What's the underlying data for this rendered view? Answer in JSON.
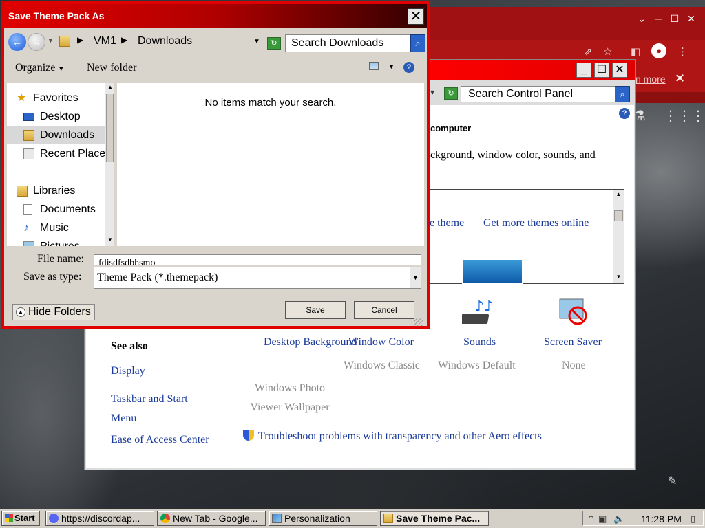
{
  "dialog": {
    "title": "Save Theme Pack As",
    "close_label": "✕",
    "breadcrumb": [
      "VM1",
      "Downloads"
    ],
    "search_placeholder": "Search Downloads",
    "toolbar": {
      "organize": "Organize",
      "new_folder": "New folder"
    },
    "nav_items": [
      {
        "label": "Favorites",
        "icon": "star-icon",
        "level": "top"
      },
      {
        "label": "Desktop",
        "icon": "desktop-icon",
        "level": "child"
      },
      {
        "label": "Downloads",
        "icon": "downloads-folder-icon",
        "level": "child",
        "selected": true
      },
      {
        "label": "Recent Places",
        "icon": "recent-places-icon",
        "level": "child"
      },
      {
        "label": "Libraries",
        "icon": "libraries-icon",
        "level": "top"
      },
      {
        "label": "Documents",
        "icon": "documents-icon",
        "level": "child"
      },
      {
        "label": "Music",
        "icon": "music-icon",
        "level": "child"
      },
      {
        "label": "Pictures",
        "icon": "pictures-icon",
        "level": "child"
      }
    ],
    "empty_message": "No items match your search.",
    "file_name_label": "File name:",
    "file_name_value": "fdjsdfsdbhsmo",
    "save_type_label": "Save as type:",
    "save_type_value": "Theme Pack (*.themepack)",
    "hide_folders": "Hide Folders",
    "save_button": "Save",
    "cancel_button": "Cancel"
  },
  "control_panel": {
    "search_placeholder": "Search Control Panel",
    "heading_fragment": "computer",
    "description_fragment": "ckground, window color, sounds, and",
    "links": {
      "save_theme_fragment": "e theme",
      "get_more_themes": "Get more themes online"
    },
    "settings": [
      {
        "title": "Desktop Background",
        "value": "Windows Photo Viewer Wallpaper",
        "icon": "desktop-background-icon"
      },
      {
        "title": "Window Color",
        "value": "Windows Classic",
        "icon": "window-color-icon"
      },
      {
        "title": "Sounds",
        "value": "Windows Default",
        "icon": "sounds-icon"
      },
      {
        "title": "Screen Saver",
        "value": "None",
        "icon": "screen-saver-icon"
      }
    ],
    "see_also_title": "See also",
    "see_also_links": [
      "Display",
      "Taskbar and Start Menu",
      "Ease of Access Center"
    ],
    "troubleshoot_link": "Troubleshoot problems with transparency and other Aero effects"
  },
  "chrome": {
    "learn_more": "n more"
  },
  "taskbar": {
    "start_label": "Start",
    "tasks": [
      {
        "label": "https://discordap...",
        "icon": "discord-icon",
        "active": false
      },
      {
        "label": "New Tab - Google...",
        "icon": "chrome-icon",
        "active": false
      },
      {
        "label": "Personalization",
        "icon": "control-panel-icon",
        "active": false
      },
      {
        "label": "Save Theme Pac...",
        "icon": "folder-icon",
        "active": true
      }
    ],
    "clock": "11:28 PM"
  },
  "colors": {
    "dialog_border": "#e00000",
    "titlebar_red": "#ff0000",
    "link_blue": "#1a3a9a",
    "chrome_red": "#b01515"
  }
}
